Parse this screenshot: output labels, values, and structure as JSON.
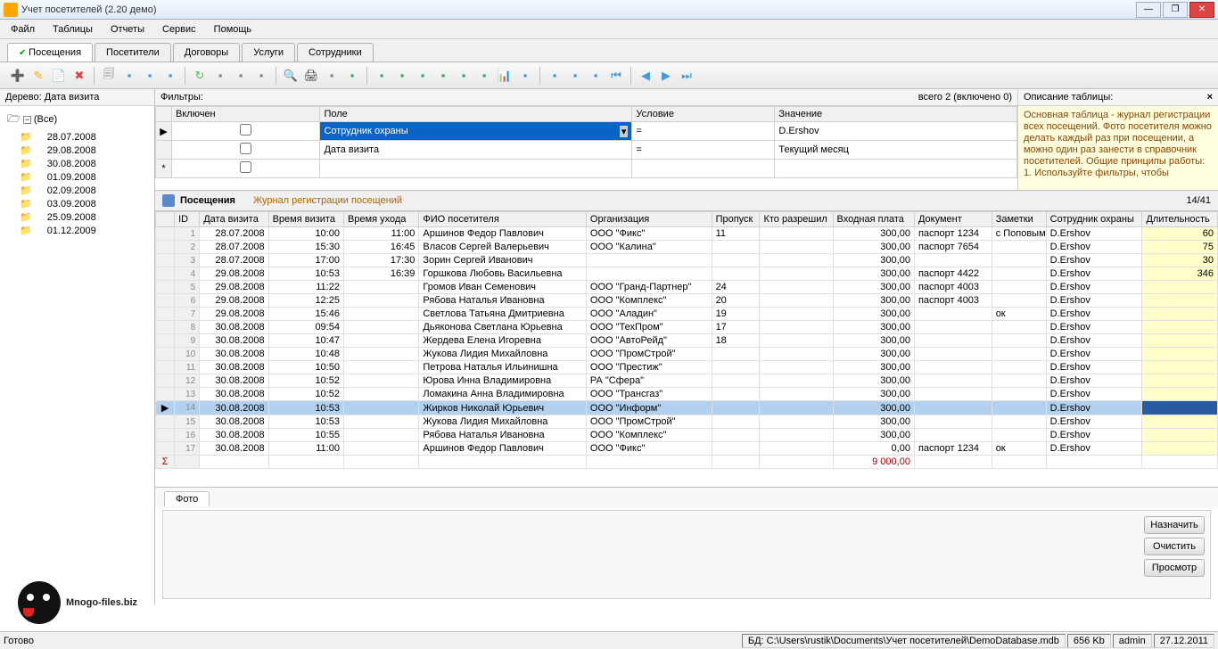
{
  "title": "Учет посетителей (2.20 демо)",
  "menu": [
    "Файл",
    "Таблицы",
    "Отчеты",
    "Сервис",
    "Помощь"
  ],
  "tabs": [
    "Посещения",
    "Посетители",
    "Договоры",
    "Услуги",
    "Сотрудники"
  ],
  "activeTab": 0,
  "tree": {
    "header": "Дерево: Дата визита",
    "root": "(Все)",
    "nodes": [
      "28.07.2008",
      "29.08.2008",
      "30.08.2008",
      "01.09.2008",
      "02.09.2008",
      "03.09.2008",
      "25.09.2008",
      "01.12.2009"
    ]
  },
  "filters": {
    "label": "Фильтры:",
    "stats": "всего 2 (включено 0)",
    "descHeader": "Описание таблицы:",
    "cols": [
      "Включен",
      "Поле",
      "Условие",
      "Значение"
    ],
    "rows": [
      {
        "enabled": false,
        "field": "Сотрудник охраны",
        "cond": "=",
        "value": "D.Ershov",
        "selected": true
      },
      {
        "enabled": false,
        "field": "Дата визита",
        "cond": "=",
        "value": "Текущий месяц",
        "selected": false
      }
    ],
    "desc": "Основная таблица - журнал регистрации всех посещений. Фото посетителя можно делать каждый раз при посещении, а можно один раз занести в справочник посетителей.\nОбщие принципы работы:\n1. Используйте фильтры, чтобы"
  },
  "grid": {
    "title": "Посещения",
    "subtitle": "Журнал регистрации посещений",
    "count": "14/41",
    "cols": [
      "ID",
      "Дата визита",
      "Время визита",
      "Время ухода",
      "ФИО посетителя",
      "Организация",
      "Пропуск",
      "Кто разрешил",
      "Входная плата",
      "Документ",
      "Заметки",
      "Сотрудник охраны",
      "Длительность"
    ],
    "widths": [
      26,
      66,
      72,
      72,
      160,
      120,
      46,
      70,
      78,
      74,
      52,
      92,
      72
    ],
    "rows": [
      {
        "id": 1,
        "d": "28.07.2008",
        "t1": "10:00",
        "t2": "11:00",
        "fio": "Аршинов Федор Павлович",
        "org": "ООО \"Фикс\"",
        "pass": "11",
        "who": "",
        "fee": "300,00",
        "doc": "паспорт 1234",
        "note": "с Поповым",
        "guard": "D.Ershov",
        "dur": "60"
      },
      {
        "id": 2,
        "d": "28.07.2008",
        "t1": "15:30",
        "t2": "16:45",
        "fio": "Власов Сергей Валерьевич",
        "org": "ООО \"Калина\"",
        "pass": "",
        "who": "",
        "fee": "300,00",
        "doc": "паспорт 7654",
        "note": "",
        "guard": "D.Ershov",
        "dur": "75"
      },
      {
        "id": 3,
        "d": "28.07.2008",
        "t1": "17:00",
        "t2": "17:30",
        "fio": "Зорин Сергей Иванович",
        "org": "",
        "pass": "",
        "who": "",
        "fee": "300,00",
        "doc": "",
        "note": "",
        "guard": "D.Ershov",
        "dur": "30"
      },
      {
        "id": 4,
        "d": "29.08.2008",
        "t1": "10:53",
        "t2": "16:39",
        "fio": "Горшкова Любовь Васильевна",
        "org": "",
        "pass": "",
        "who": "",
        "fee": "300,00",
        "doc": "паспорт 4422",
        "note": "",
        "guard": "D.Ershov",
        "dur": "346"
      },
      {
        "id": 5,
        "d": "29.08.2008",
        "t1": "11:22",
        "t2": "",
        "fio": "Громов Иван Семенович",
        "org": "ООО \"Гранд-Партнер\"",
        "pass": "24",
        "who": "",
        "fee": "300,00",
        "doc": "паспорт 4003",
        "note": "",
        "guard": "D.Ershov",
        "dur": ""
      },
      {
        "id": 6,
        "d": "29.08.2008",
        "t1": "12:25",
        "t2": "",
        "fio": "Рябова Наталья Ивановна",
        "org": "ООО \"Комплекс\"",
        "pass": "20",
        "who": "",
        "fee": "300,00",
        "doc": "паспорт 4003",
        "note": "",
        "guard": "D.Ershov",
        "dur": ""
      },
      {
        "id": 7,
        "d": "29.08.2008",
        "t1": "15:46",
        "t2": "",
        "fio": "Светлова Татьяна Дмитриевна",
        "org": "ООО \"Аладин\"",
        "pass": "19",
        "who": "",
        "fee": "300,00",
        "doc": "",
        "note": "ок",
        "guard": "D.Ershov",
        "dur": ""
      },
      {
        "id": 8,
        "d": "30.08.2008",
        "t1": "09:54",
        "t2": "",
        "fio": "Дьяконова Светлана Юрьевна",
        "org": "ООО \"ТехПром\"",
        "pass": "17",
        "who": "",
        "fee": "300,00",
        "doc": "",
        "note": "",
        "guard": "D.Ershov",
        "dur": ""
      },
      {
        "id": 9,
        "d": "30.08.2008",
        "t1": "10:47",
        "t2": "",
        "fio": "Жердева Елена Игоревна",
        "org": "ООО \"АвтоРейд\"",
        "pass": "18",
        "who": "",
        "fee": "300,00",
        "doc": "",
        "note": "",
        "guard": "D.Ershov",
        "dur": ""
      },
      {
        "id": 10,
        "d": "30.08.2008",
        "t1": "10:48",
        "t2": "",
        "fio": "Жукова Лидия Михайловна",
        "org": "ООО \"ПромСтрой\"",
        "pass": "",
        "who": "",
        "fee": "300,00",
        "doc": "",
        "note": "",
        "guard": "D.Ershov",
        "dur": ""
      },
      {
        "id": 11,
        "d": "30.08.2008",
        "t1": "10:50",
        "t2": "",
        "fio": "Петрова Наталья Ильинишна",
        "org": "ООО \"Престиж\"",
        "pass": "",
        "who": "",
        "fee": "300,00",
        "doc": "",
        "note": "",
        "guard": "D.Ershov",
        "dur": ""
      },
      {
        "id": 12,
        "d": "30.08.2008",
        "t1": "10:52",
        "t2": "",
        "fio": "Юрова Инна Владимировна",
        "org": "РА \"Сфера\"",
        "pass": "",
        "who": "",
        "fee": "300,00",
        "doc": "",
        "note": "",
        "guard": "D.Ershov",
        "dur": ""
      },
      {
        "id": 13,
        "d": "30.08.2008",
        "t1": "10:52",
        "t2": "",
        "fio": "Ломакина Анна Владимировна",
        "org": "ООО \"Трансгаз\"",
        "pass": "",
        "who": "",
        "fee": "300,00",
        "doc": "",
        "note": "",
        "guard": "D.Ershov",
        "dur": ""
      },
      {
        "id": 14,
        "d": "30.08.2008",
        "t1": "10:53",
        "t2": "",
        "fio": "Жирков Николай Юрьевич",
        "org": "ООО \"Информ\"",
        "pass": "",
        "who": "",
        "fee": "300,00",
        "doc": "",
        "note": "",
        "guard": "D.Ershov",
        "dur": "",
        "sel": true
      },
      {
        "id": 15,
        "d": "30.08.2008",
        "t1": "10:53",
        "t2": "",
        "fio": "Жукова Лидия Михайловна",
        "org": "ООО \"ПромСтрой\"",
        "pass": "",
        "who": "",
        "fee": "300,00",
        "doc": "",
        "note": "",
        "guard": "D.Ershov",
        "dur": ""
      },
      {
        "id": 16,
        "d": "30.08.2008",
        "t1": "10:55",
        "t2": "",
        "fio": "Рябова Наталья Ивановна",
        "org": "ООО \"Комплекс\"",
        "pass": "",
        "who": "",
        "fee": "300,00",
        "doc": "",
        "note": "",
        "guard": "D.Ershov",
        "dur": ""
      },
      {
        "id": 17,
        "d": "30.08.2008",
        "t1": "11:00",
        "t2": "",
        "fio": "Аршинов Федор Павлович",
        "org": "ООО \"Фикс\"",
        "pass": "",
        "who": "",
        "fee": "0,00",
        "doc": "паспорт 1234",
        "note": "ок",
        "guard": "D.Ershov",
        "dur": ""
      }
    ],
    "sum": "9 000,00"
  },
  "photo": {
    "tab": "Фото",
    "buttons": [
      "Назначить",
      "Очистить",
      "Просмотр"
    ]
  },
  "status": {
    "ready": "Готово",
    "dbLabel": "БД:",
    "dbPath": "C:\\Users\\rustik\\Documents\\Учет посетителей\\DemoDatabase.mdb",
    "size": "656 Kb",
    "user": "admin",
    "date": "27.12.2011"
  },
  "watermark": "Mnogo-files.biz",
  "toolbarIcons": [
    "➕",
    "✎",
    "📄",
    "✖",
    "🗐",
    "▪",
    "▪",
    "▪",
    "↻",
    "▪",
    "▪",
    "▪",
    "🔍",
    "🖨",
    "▪",
    "▪",
    "▪",
    "▪",
    "▪",
    "▪",
    "▪",
    "▪",
    "📊",
    "▪",
    "▪",
    "▪",
    "▪",
    "⏮",
    "◀",
    "▶",
    "⏭"
  ]
}
